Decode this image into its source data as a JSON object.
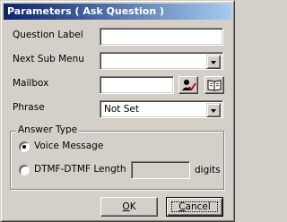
{
  "window": {
    "title": "Parameters ( Ask Question )"
  },
  "form": {
    "question_label": {
      "label": "Question Label",
      "value": ""
    },
    "next_sub_menu": {
      "label": "Next Sub Menu",
      "value": ""
    },
    "mailbox": {
      "label": "Mailbox",
      "value": "",
      "select_icon": "user-check-icon",
      "browse_icon": "book-icon"
    },
    "phrase": {
      "label": "Phrase",
      "value": "Not Set"
    }
  },
  "answer_type": {
    "legend": "Answer Type",
    "options": [
      {
        "label": "Voice Message",
        "selected": true
      },
      {
        "label": "DTMF-DTMF Length",
        "selected": false
      }
    ],
    "dtmf_length": {
      "value": "",
      "unit": "digits"
    }
  },
  "buttons": {
    "ok": {
      "accel": "O",
      "rest": "K"
    },
    "cancel": {
      "accel": "C",
      "rest": "ancel"
    }
  }
}
